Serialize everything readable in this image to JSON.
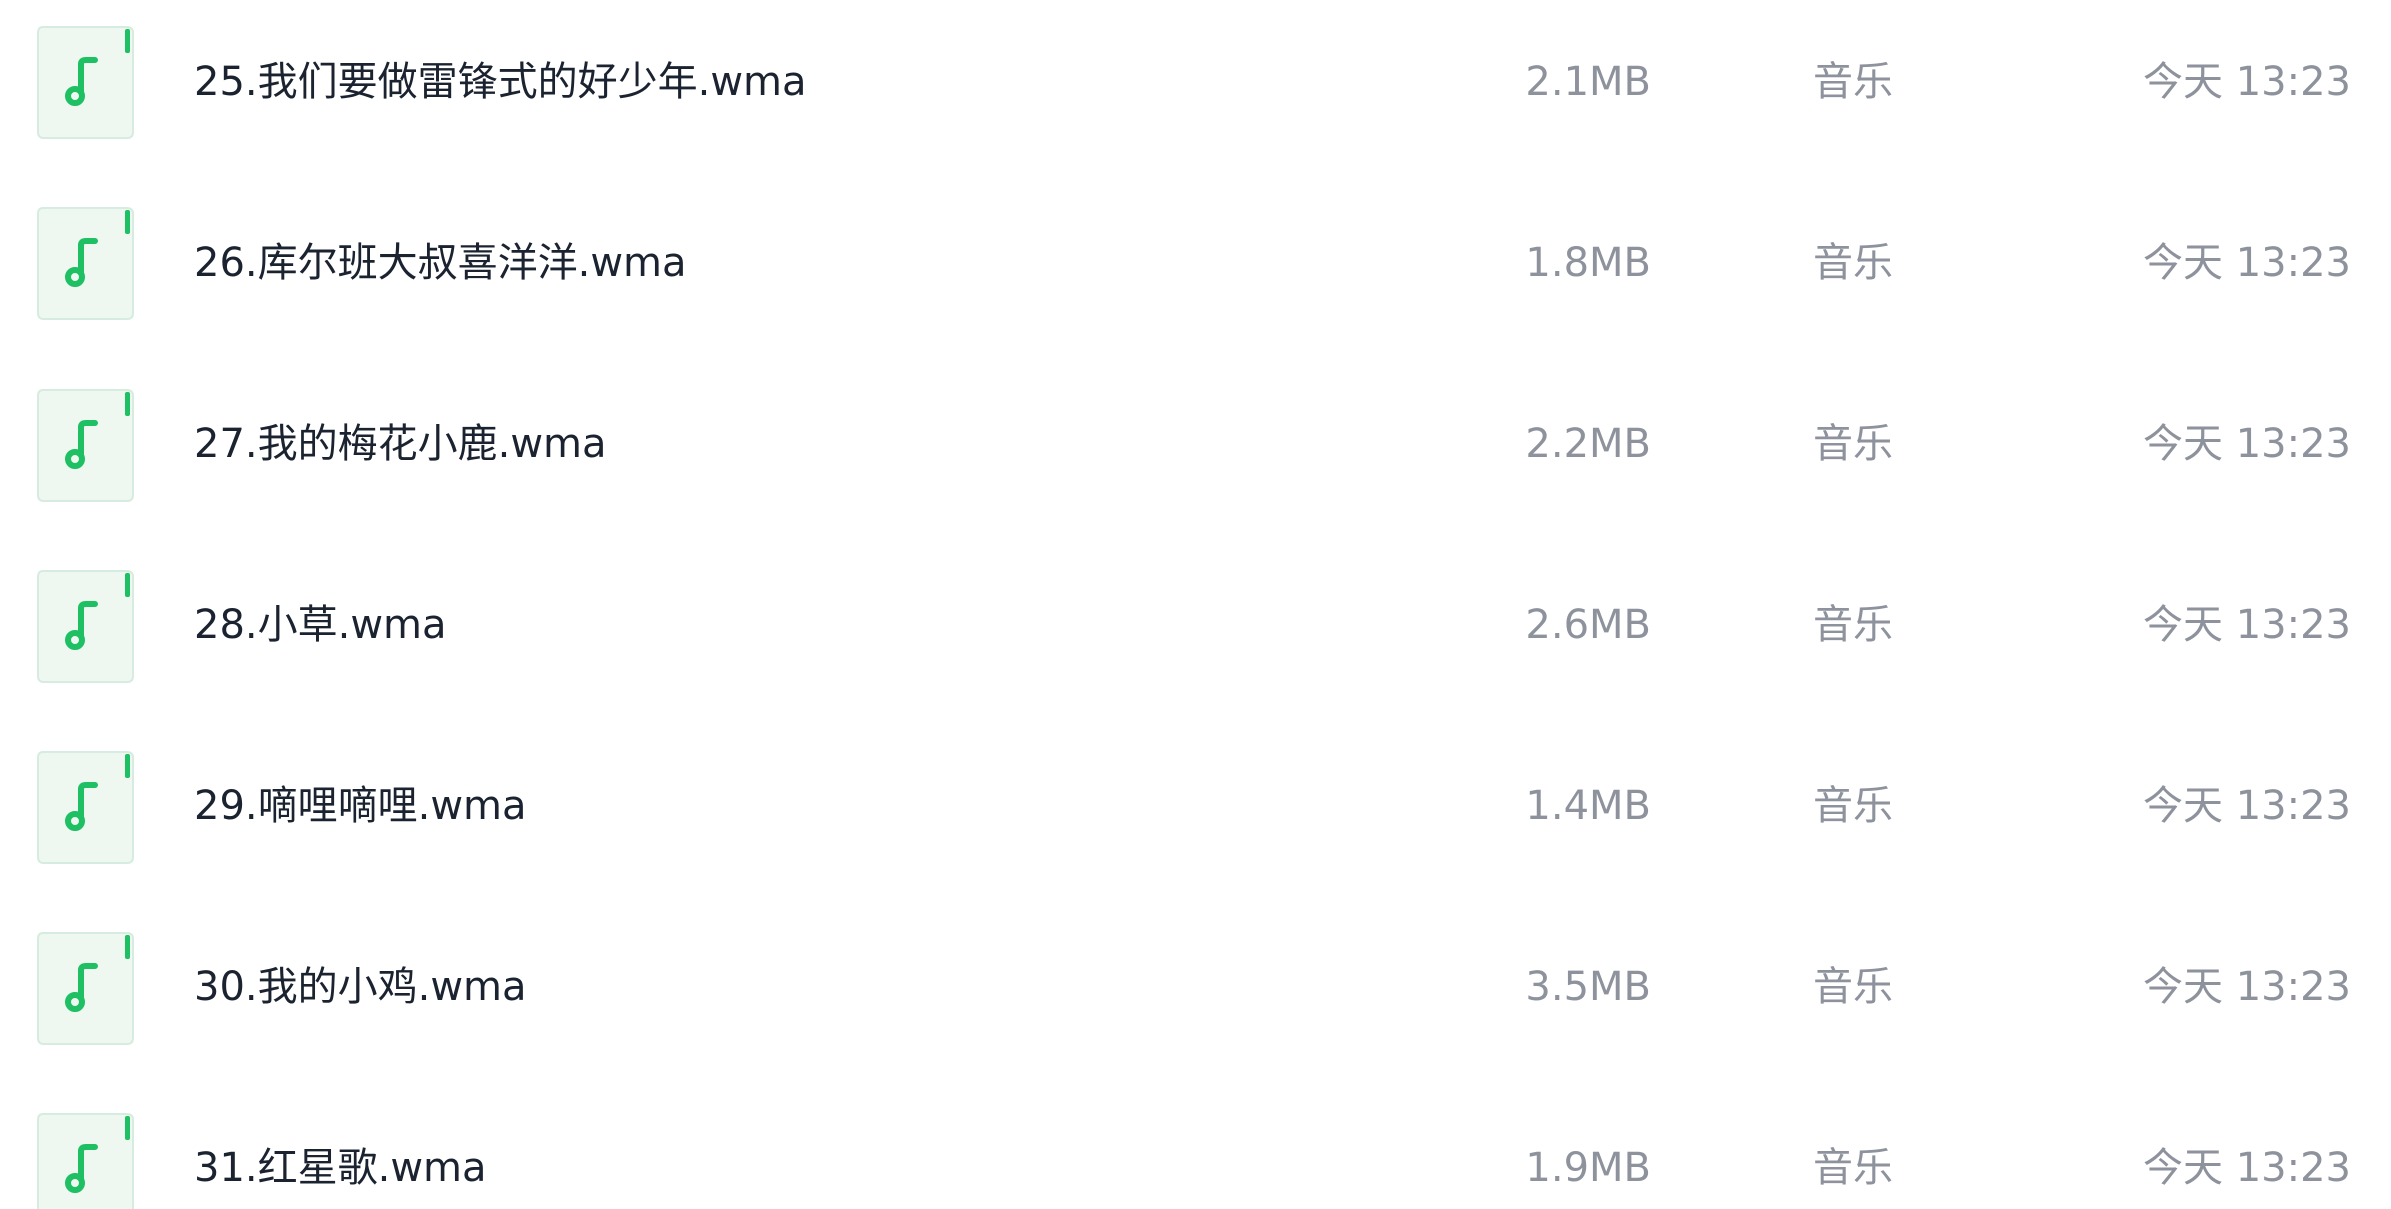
{
  "colors": {
    "accent_green": "#1fbf63",
    "icon_background": "#eef8f1",
    "icon_border": "#d7ece0",
    "filename_text": "#1b2330",
    "meta_text": "#8d929c"
  },
  "files": [
    {
      "name": "25.我们要做雷锋式的好少年.wma",
      "size": "2.1MB",
      "type": "音乐",
      "modified": "今天 13:23",
      "icon": "music-note-icon"
    },
    {
      "name": "26.库尔班大叔喜洋洋.wma",
      "size": "1.8MB",
      "type": "音乐",
      "modified": "今天 13:23",
      "icon": "music-note-icon"
    },
    {
      "name": "27.我的梅花小鹿.wma",
      "size": "2.2MB",
      "type": "音乐",
      "modified": "今天 13:23",
      "icon": "music-note-icon"
    },
    {
      "name": "28.小草.wma",
      "size": "2.6MB",
      "type": "音乐",
      "modified": "今天 13:23",
      "icon": "music-note-icon"
    },
    {
      "name": "29.嘀哩嘀哩.wma",
      "size": "1.4MB",
      "type": "音乐",
      "modified": "今天 13:23",
      "icon": "music-note-icon"
    },
    {
      "name": "30.我的小鸡.wma",
      "size": "3.5MB",
      "type": "音乐",
      "modified": "今天 13:23",
      "icon": "music-note-icon"
    },
    {
      "name": "31.红星歌.wma",
      "size": "1.9MB",
      "type": "音乐",
      "modified": "今天 13:23",
      "icon": "music-note-icon"
    }
  ]
}
